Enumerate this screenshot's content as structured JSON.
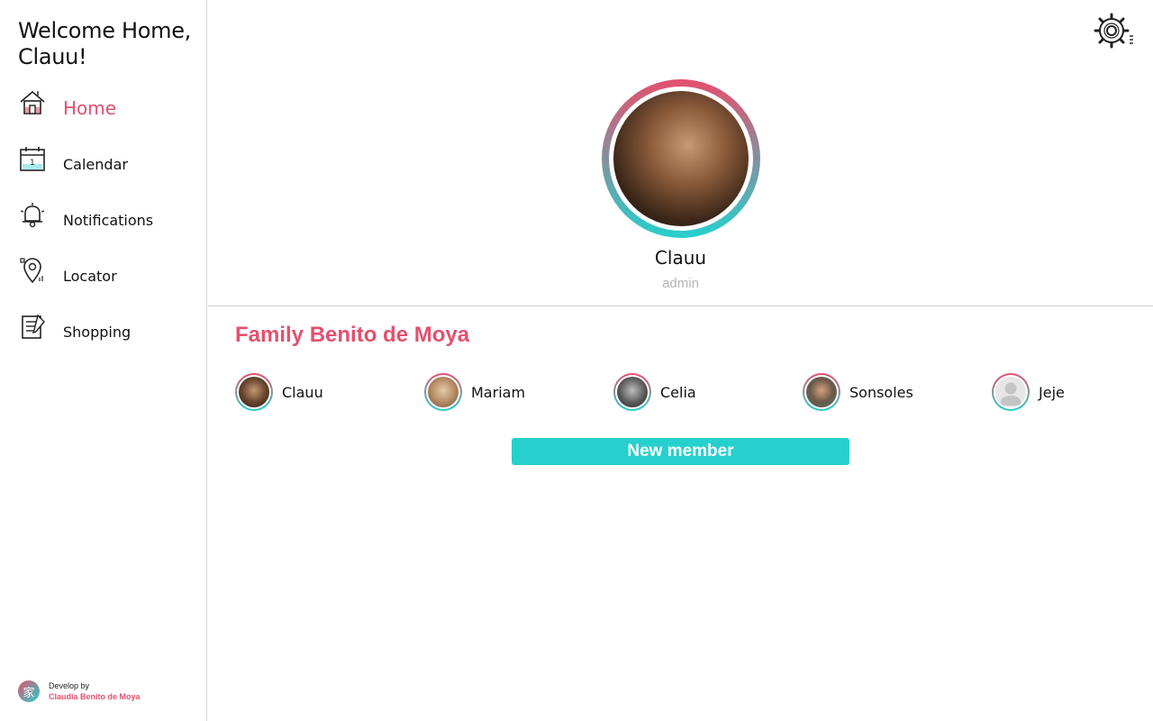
{
  "sidebar": {
    "welcome": "Welcome Home, Clauu!",
    "items": [
      {
        "label": "Home",
        "icon": "home-icon",
        "active": true
      },
      {
        "label": "Calendar",
        "icon": "calendar-icon",
        "active": false
      },
      {
        "label": "Notifications",
        "icon": "bell-icon",
        "active": false
      },
      {
        "label": "Locator",
        "icon": "map-pin-icon",
        "active": false
      },
      {
        "label": "Shopping",
        "icon": "shopping-list-icon",
        "active": false
      }
    ],
    "footer": {
      "prefix": "Develop by",
      "name": "Claudia Benito de Moya",
      "logo_glyph": "家"
    }
  },
  "profile": {
    "name": "Clauu",
    "role": "admin"
  },
  "family": {
    "title": "Family Benito de Moya",
    "members": [
      {
        "name": "Clauu"
      },
      {
        "name": "Mariam"
      },
      {
        "name": "Celia"
      },
      {
        "name": "Sonsoles"
      },
      {
        "name": "Jeje"
      }
    ],
    "new_member_label": "New member"
  },
  "colors": {
    "accent": "#e4506e",
    "teal": "#26d0ce",
    "muted": "#b5b5b5"
  },
  "icons": {
    "settings": "gear-icon"
  }
}
